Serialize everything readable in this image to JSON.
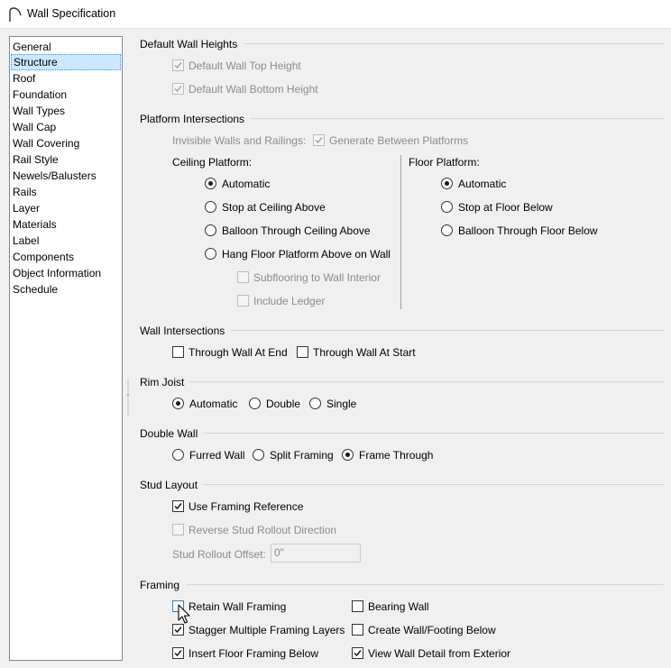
{
  "window": {
    "title": "Wall Specification",
    "icon": "arc-icon"
  },
  "sidebar": {
    "selected": "Structure",
    "items": [
      {
        "label": "General"
      },
      {
        "label": "Structure"
      },
      {
        "label": "Roof"
      },
      {
        "label": "Foundation"
      },
      {
        "label": "Wall Types"
      },
      {
        "label": "Wall Cap"
      },
      {
        "label": "Wall Covering"
      },
      {
        "label": "Rail Style"
      },
      {
        "label": "Newels/Balusters"
      },
      {
        "label": "Rails"
      },
      {
        "label": "Layer"
      },
      {
        "label": "Materials"
      },
      {
        "label": "Label"
      },
      {
        "label": "Components"
      },
      {
        "label": "Object Information"
      },
      {
        "label": "Schedule"
      }
    ]
  },
  "default_wall_heights": {
    "title": "Default Wall Heights",
    "top": {
      "label": "Default Wall Top Height",
      "checked": true,
      "disabled": true
    },
    "bottom": {
      "label": "Default Wall Bottom Height",
      "checked": true,
      "disabled": true
    }
  },
  "platform_intersections": {
    "title": "Platform Intersections",
    "invisible_label": "Invisible Walls and Railings:",
    "generate_between": {
      "label": "Generate Between Platforms",
      "checked": true,
      "disabled": true
    },
    "ceiling": {
      "title": "Ceiling Platform:",
      "options": [
        "Automatic",
        "Stop at Ceiling Above",
        "Balloon Through Ceiling Above",
        "Hang Floor Platform Above on Wall"
      ],
      "selected": "Automatic",
      "subflooring": {
        "label": "Subflooring to Wall Interior",
        "checked": false,
        "disabled": true
      },
      "ledger": {
        "label": "Include Ledger",
        "checked": false,
        "disabled": true
      }
    },
    "floor": {
      "title": "Floor Platform:",
      "options": [
        "Automatic",
        "Stop at Floor Below",
        "Balloon Through Floor Below"
      ],
      "selected": "Automatic"
    }
  },
  "wall_intersections": {
    "title": "Wall Intersections",
    "end": {
      "label": "Through Wall At End",
      "checked": false
    },
    "start": {
      "label": "Through Wall At Start",
      "checked": false
    }
  },
  "rim_joist": {
    "title": "Rim Joist",
    "options": [
      "Automatic",
      "Double",
      "Single"
    ],
    "selected": "Automatic"
  },
  "double_wall": {
    "title": "Double Wall",
    "options": [
      "Furred Wall",
      "Split Framing",
      "Frame Through"
    ],
    "selected": "Frame Through"
  },
  "stud_layout": {
    "title": "Stud Layout",
    "use_framing_reference": {
      "label": "Use Framing Reference",
      "checked": true
    },
    "reverse_rollout": {
      "label": "Reverse Stud Rollout Direction",
      "checked": false,
      "disabled": true
    },
    "rollout_offset_label": "Stud Rollout Offset:",
    "rollout_offset_value": "0\""
  },
  "framing": {
    "title": "Framing",
    "retain": {
      "label": "Retain Wall Framing",
      "checked": false
    },
    "stagger": {
      "label": "Stagger Multiple Framing Layers",
      "checked": true
    },
    "insert_floor": {
      "label": "Insert Floor Framing Below",
      "checked": true
    },
    "bearing": {
      "label": "Bearing Wall",
      "checked": false
    },
    "create_footing": {
      "label": "Create Wall/Footing Below",
      "checked": false
    },
    "view_detail": {
      "label": "View Wall Detail from Exterior",
      "checked": true
    }
  },
  "colors": {
    "selection_bg": "#cce8ff",
    "selection_border": "#3399ff",
    "disabled_text": "#8c8c8c",
    "dialog_bg": "#f0f0f0"
  }
}
